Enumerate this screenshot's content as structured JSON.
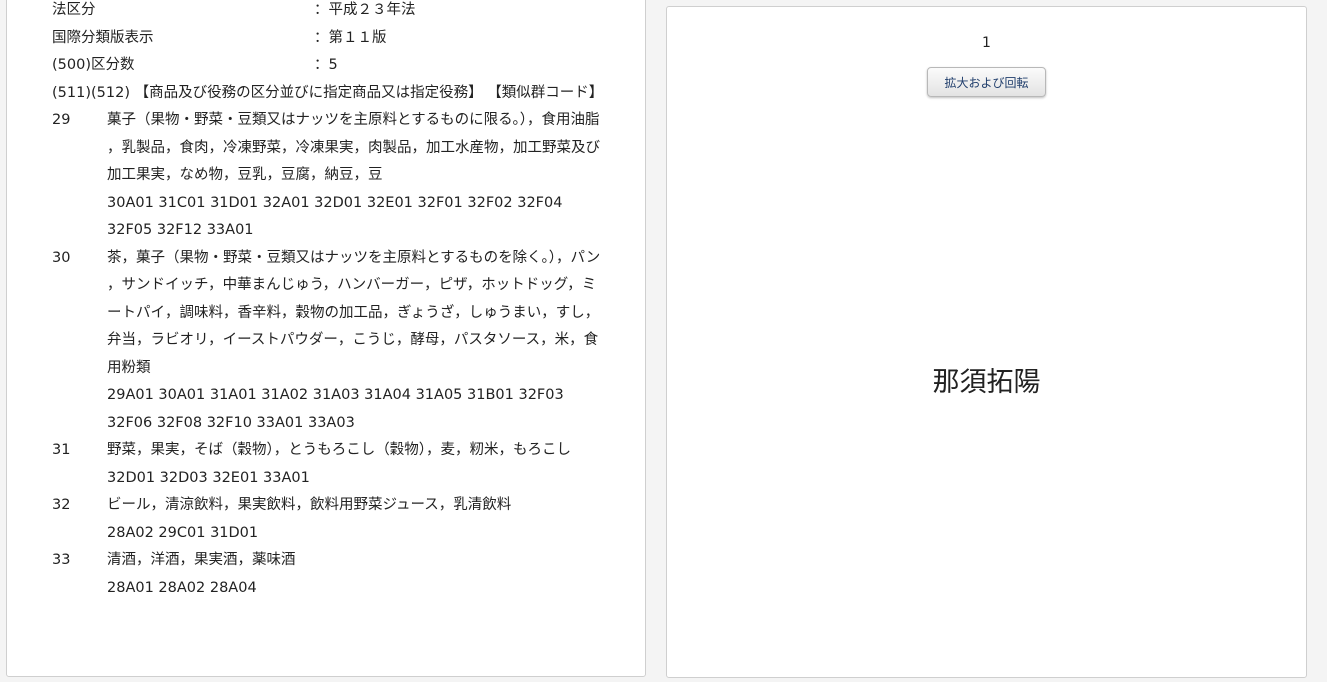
{
  "summary": {
    "law_label": "法区分",
    "law_value": "：平成２３年法",
    "intl_label": "国際分類版表示",
    "intl_value": "：第１１版",
    "count_label": "(500)区分数",
    "count_value": "：5",
    "goods_heading": "(511)(512) 【商品及び役務の区分並びに指定商品又は指定役務】 【類似群コード】"
  },
  "classes": [
    {
      "num": "29",
      "goods": "菓子（果物・野菜・豆類又はナッツを主原料とするものに限る。），食用油脂，乳製品，食肉，冷凍野菜，冷凍果実，肉製品，加工水産物，加工野菜及び加工果実，なめ物，豆乳，豆腐，納豆，豆",
      "codes": "30A01 31C01 31D01 32A01 32D01 32E01 32F01 32F02 32F04 32F05 32F12 33A01"
    },
    {
      "num": "30",
      "goods": "茶，菓子（果物・野菜・豆類又はナッツを主原料とするものを除く。），パン，サンドイッチ，中華まんじゅう，ハンバーガー，ピザ，ホットドッグ，ミートパイ，調味料，香辛料，穀物の加工品，ぎょうざ，しゅうまい，すし，弁当，ラビオリ，イーストパウダー，こうじ，酵母，パスタソース，米，食用粉類",
      "codes": "29A01 30A01 31A01 31A02 31A03 31A04 31A05 31B01 32F03 32F06 32F08 32F10 33A01 33A03"
    },
    {
      "num": "31",
      "goods": "野菜，果実，そば（穀物），とうもろこし（穀物），麦，籾米，もろこし",
      "codes": "32D01 32D03 32E01 33A01"
    },
    {
      "num": "32",
      "goods": "ビール，清涼飲料，果実飲料，飲料用野菜ジュース，乳清飲料",
      "codes": "28A02 29C01 31D01"
    },
    {
      "num": "33",
      "goods": "清酒，洋酒，果実酒，薬味酒",
      "codes": "28A01 28A02 28A04"
    }
  ],
  "viewer": {
    "page_number": "1",
    "zoom_button_label": "拡大および回転",
    "mark_text": "那須拓陽"
  }
}
